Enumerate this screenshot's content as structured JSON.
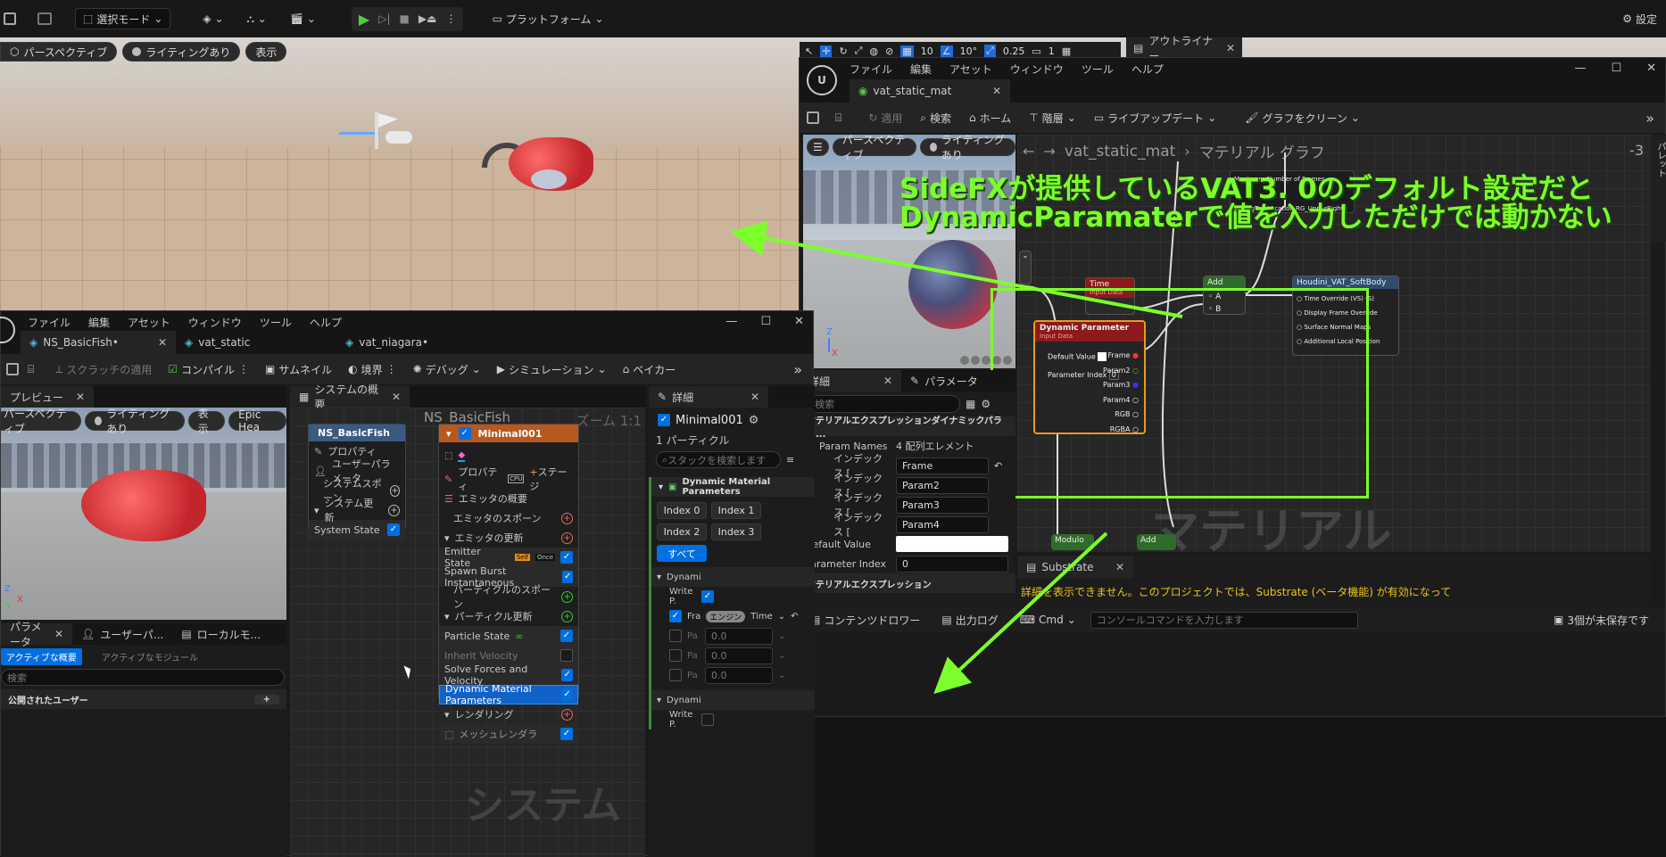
{
  "main_toolbar": {
    "mode": "選択モード",
    "platform": "プラットフォーム",
    "settings": "設定"
  },
  "viewport": {
    "perspective": "パースペクティブ",
    "lighting": "ライティングあり",
    "show": "表示",
    "grid_snap": "10",
    "rot_snap": "10°",
    "scale_snap": "0.25",
    "cam_speed": "1"
  },
  "outliner": {
    "title": "アウトライナー"
  },
  "mat_editor": {
    "menu": [
      "ファイル",
      "編集",
      "アセット",
      "ウィンドウ",
      "ツール",
      "ヘルプ"
    ],
    "tab": "vat_static_mat",
    "toolbar": {
      "apply": "適用",
      "search": "検索",
      "home": "ホーム",
      "hierarchy": "階層",
      "live_update": "ライブアップデート",
      "clean_graph": "グラフをクリーン"
    },
    "preview": {
      "perspective": "パースペクティブ",
      "lighting": "ライティングあり"
    },
    "breadcrumb": {
      "asset": "vat_static_mat",
      "graph": "マテリアル グラフ",
      "zoom": "-3"
    },
    "side_tab": "パレット",
    "watermark": "マテリアル",
    "nodes": {
      "time_title": "Time",
      "time_sub": "Input Data",
      "dp_title": "Dynamic Parameter",
      "dp_sub": "Input Data",
      "dp_default": "Default Value",
      "dp_index": "Parameter Index",
      "dp_index_val": "0",
      "dp_pins": [
        "Frame",
        "Param2",
        "Param3",
        "Param4",
        "RGB",
        "RGBA"
      ],
      "add_title": "Add",
      "add_a": "A",
      "add_b": "B",
      "houdini_title": "Houdini_VAT_SoftBody",
      "houdini_pins": [
        "Time Override (VS) (S)",
        "Display Frame Override",
        "Surface Normal Maps",
        "Additional Local Position"
      ],
      "debug1": "Maximum Number of Frames",
      "debug2": "DebugTextLocation RG_UpperRight BA_LowerLeft",
      "modulo": "Modulo",
      "add2": "Add"
    },
    "details": {
      "tab": "詳細",
      "params_tab": "パラメータ",
      "search_placeholder": "検索",
      "section": "マテリアルエクスプレッションダイナミックパラメ...",
      "param_names": "Param Names",
      "param_count": "4 配列エレメント",
      "index_label": "インデックス [",
      "values": [
        "Frame",
        "Param2",
        "Param3",
        "Param4"
      ],
      "default_value": "Default Value",
      "param_index": "Parameter Index",
      "param_index_val": "0",
      "section2": "マテリアルエクスプレッション"
    },
    "substrate": {
      "tab": "Substrate",
      "message": "詳細を表示できません。このプロジェクトでは、Substrate (ベータ機能) が有効になって"
    },
    "bottom": {
      "content_drawer": "コンテンツドロワー",
      "output_log": "出力ログ",
      "cmd": "Cmd",
      "console_placeholder": "コンソールコマンドを入力します",
      "unsaved": "3個が未保存です"
    }
  },
  "annotation": {
    "line1": "SideFXが提供しているVAT3. 0のデフォルト設定だと",
    "line2": "DynamicParamaterで値を入力しただけでは動かない",
    "color": "#7CFF2A"
  },
  "niagara": {
    "menu": [
      "ファイル",
      "編集",
      "アセット",
      "ウィンドウ",
      "ツール",
      "ヘルプ"
    ],
    "tabs": [
      "NS_BasicFish•",
      "vat_static",
      "vat_niagara•"
    ],
    "toolbar": {
      "scratch": "スクラッチの適用",
      "compile": "コンパイル",
      "thumbnail": "サムネイル",
      "bounds": "境界",
      "debug": "デバッグ",
      "simulation": "シミュレーション",
      "baker": "ベイカー"
    },
    "preview": {
      "tab": "プレビュー",
      "perspective": "パースペクティブ",
      "lighting": "ライティングあり",
      "show": "表示",
      "epic": "Epic Hea"
    },
    "system_overview": {
      "tab": "システムの概要",
      "title": "NS_BasicFish",
      "zoom": "ズーム 1:1",
      "watermark": "システム"
    },
    "system_node": {
      "title": "NS_BasicFish",
      "items": [
        "プロパティ",
        "ユーザーパラメータ",
        "システムスポーン",
        "システム更新",
        "System State"
      ]
    },
    "emitter": {
      "title": "Minimal001",
      "props": "プロパティ",
      "cpu": "CPU",
      "stage": "ステージ",
      "summary": "エミッタの概要",
      "spawn": "エミッタのスポーン",
      "update": "エミッタの更新",
      "emitter_state": "Emitter State",
      "self": "Self",
      "once": "Once",
      "spawn_burst": "Spawn Burst Instantaneous",
      "particle_spawn": "パーティクルのスポーン",
      "particle_update": "パーティクル更新",
      "particle_state": "Particle State",
      "inherit_velocity": "Inherit Velocity",
      "solve_forces": "Solve Forces and Velocity",
      "dmp": "Dynamic Material Parameters",
      "rendering": "レンダリング",
      "mesh_renderer": "メッシュレンダラ"
    },
    "details": {
      "tab": "詳細",
      "emitter": "Minimal001",
      "particles": "1 パーティクル",
      "search_placeholder": "スタックを検索します",
      "dmp_section": "Dynamic Material Parameters",
      "index0": "Index 0",
      "index1": "Index 1",
      "index2": "Index 2",
      "index3": "Index 3",
      "all": "すべて",
      "dyn": "Dynami",
      "write": "Write P.",
      "fra": "Fra",
      "engine": "エンジン",
      "time": "Time",
      "pa": "Pa",
      "zero": "0.0"
    },
    "params": {
      "tab": "パラメータ",
      "user_tab": "ユーザーパ...",
      "local_tab": "ローカルモ...",
      "active_overview": "アクティブな概要",
      "active_modules": "アクティブなモジュール",
      "search_placeholder": "検索",
      "user_exposed": "公開されたユーザー"
    }
  }
}
